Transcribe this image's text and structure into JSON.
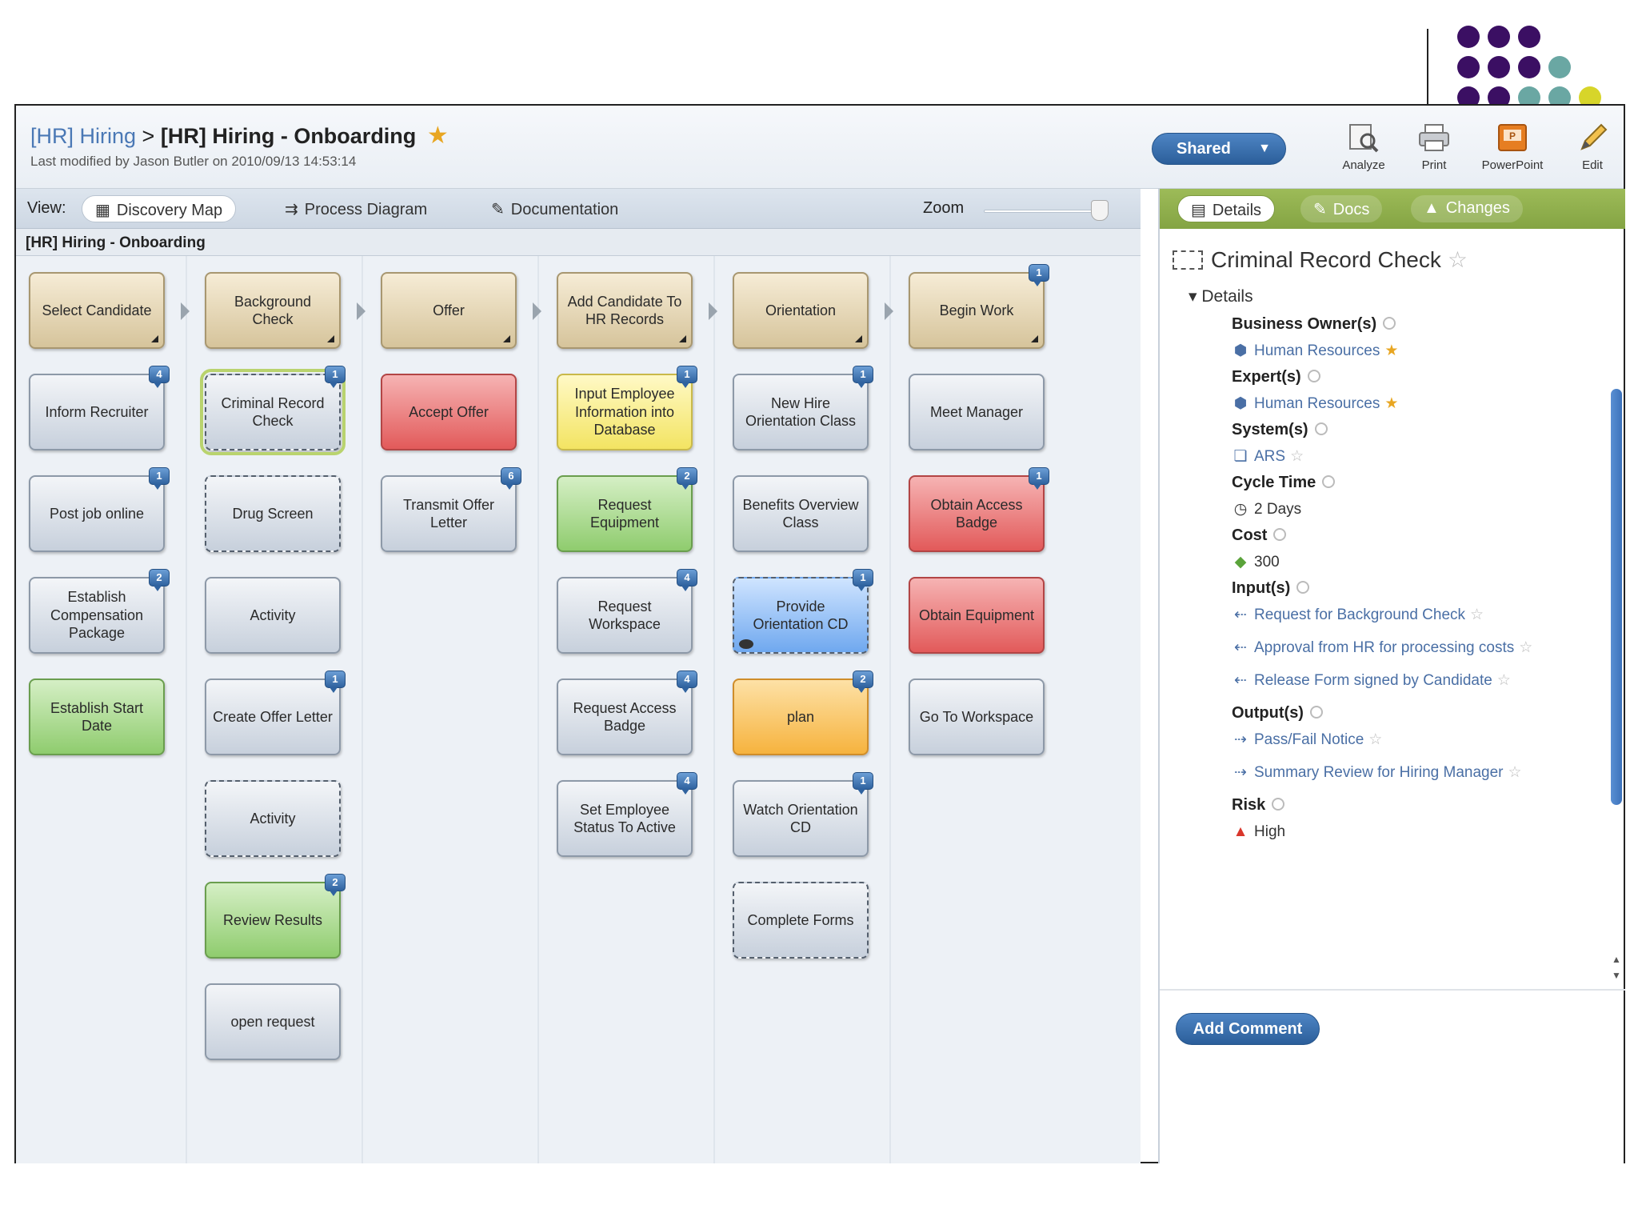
{
  "header": {
    "breadcrumb_parent": "[HR] Hiring",
    "breadcrumb_sep": ">",
    "breadcrumb_current": "[HR] Hiring - Onboarding",
    "modified": "Last modified by Jason Butler on 2010/09/13 14:53:14"
  },
  "toolbar": {
    "shared_label": "Shared",
    "analyze": "Analyze",
    "print": "Print",
    "powerpoint": "PowerPoint",
    "edit": "Edit"
  },
  "view": {
    "label": "View:",
    "tabs": [
      "Discovery Map",
      "Process Diagram",
      "Documentation"
    ],
    "zoom_label": "Zoom"
  },
  "map_title": "[HR] Hiring - Onboarding",
  "columns": [
    {
      "activities": [
        {
          "label": "Select Candidate",
          "color": "tan",
          "corner": true
        },
        {
          "label": "Inform Recruiter",
          "color": "gray",
          "badge": "4"
        },
        {
          "label": "Post job online",
          "color": "gray",
          "badge": "1"
        },
        {
          "label": "Establish Compensation Package",
          "color": "gray",
          "badge": "2"
        },
        {
          "label": "Establish Start Date",
          "color": "green"
        }
      ]
    },
    {
      "activities": [
        {
          "label": "Background Check",
          "color": "tan",
          "corner": true
        },
        {
          "label": "Criminal Record Check",
          "color": "gray",
          "dashed": true,
          "selected": true,
          "badge": "1"
        },
        {
          "label": "Drug Screen",
          "color": "gray",
          "dashed": true
        },
        {
          "label": "Activity",
          "color": "gray"
        },
        {
          "label": "Create Offer Letter",
          "color": "gray",
          "badge": "1"
        },
        {
          "label": "Activity",
          "color": "gray",
          "dashed": true
        },
        {
          "label": "Review Results",
          "color": "green",
          "badge": "2"
        },
        {
          "label": "open request",
          "color": "gray"
        }
      ]
    },
    {
      "activities": [
        {
          "label": "Offer",
          "color": "tan",
          "corner": true
        },
        {
          "label": "Accept Offer",
          "color": "red"
        },
        {
          "label": "Transmit Offer Letter",
          "color": "gray",
          "badge": "6"
        }
      ]
    },
    {
      "activities": [
        {
          "label": "Add Candidate To HR Records",
          "color": "tan",
          "corner": true
        },
        {
          "label": "Input Employee Information into Database",
          "color": "yellow",
          "badge": "1"
        },
        {
          "label": "Request Equipment",
          "color": "green",
          "badge": "2"
        },
        {
          "label": "Request Workspace",
          "color": "gray",
          "badge": "4"
        },
        {
          "label": "Request Access Badge",
          "color": "gray",
          "badge": "4"
        },
        {
          "label": "Set Employee Status To Active",
          "color": "gray",
          "badge": "4"
        }
      ]
    },
    {
      "activities": [
        {
          "label": "Orientation",
          "color": "tan",
          "corner": true
        },
        {
          "label": "New Hire Orientation Class",
          "color": "gray",
          "badge": "1"
        },
        {
          "label": "Benefits Overview Class",
          "color": "gray"
        },
        {
          "label": "Provide Orientation CD",
          "color": "blue",
          "dashed": true,
          "badge": "1",
          "eye": true
        },
        {
          "label": "plan",
          "color": "orange",
          "badge": "2"
        },
        {
          "label": "Watch Orientation CD",
          "color": "gray",
          "badge": "1"
        },
        {
          "label": "Complete Forms",
          "color": "gray",
          "dashed": true
        }
      ]
    },
    {
      "activities": [
        {
          "label": "Begin Work",
          "color": "tan",
          "corner": true,
          "badge": "1"
        },
        {
          "label": "Meet Manager",
          "color": "gray"
        },
        {
          "label": "Obtain Access Badge",
          "color": "red",
          "badge": "1"
        },
        {
          "label": "Obtain Equipment",
          "color": "red"
        },
        {
          "label": "Go To Workspace",
          "color": "gray"
        }
      ]
    }
  ],
  "panel": {
    "tabs": [
      "Details",
      "Docs",
      "Changes"
    ],
    "title": "Criminal Record Check",
    "section": "Details",
    "business_owners_label": "Business Owner(s)",
    "business_owner": "Human Resources",
    "experts_label": "Expert(s)",
    "expert": "Human Resources",
    "systems_label": "System(s)",
    "system": "ARS",
    "cycle_time_label": "Cycle Time",
    "cycle_time": "2 Days",
    "cost_label": "Cost",
    "cost": "300",
    "inputs_label": "Input(s)",
    "inputs": [
      "Request for Background Check",
      "Approval from HR for processing costs",
      "Release Form signed by Candidate"
    ],
    "outputs_label": "Output(s)",
    "outputs": [
      "Pass/Fail Notice",
      "Summary Review for Hiring Manager"
    ],
    "risk_label": "Risk",
    "risk": "High",
    "add_comment": "Add Comment"
  }
}
